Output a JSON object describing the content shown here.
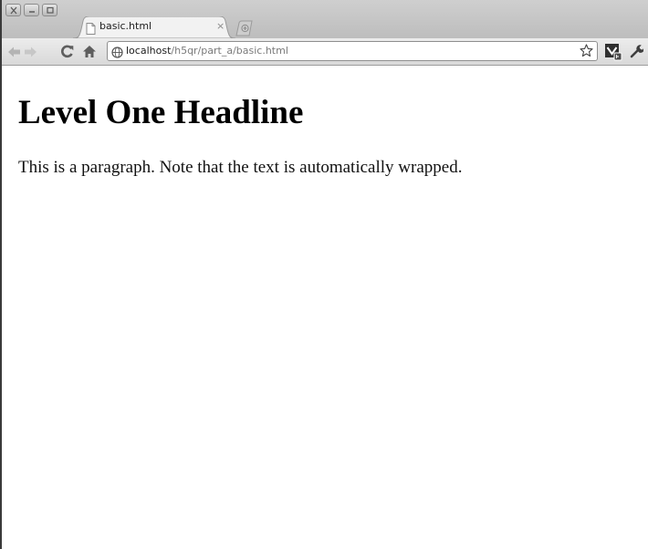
{
  "browser": {
    "tab": {
      "title": "basic.html",
      "close_glyph": "×",
      "favicon": "document-icon"
    },
    "new_tab_icon": "new-tab-icon",
    "window_controls": [
      "close-icon",
      "minimize-icon",
      "maximize-icon"
    ],
    "toolbar": {
      "nav_icons": [
        "back-arrow-icon",
        "forward-arrow-icon",
        "reload-icon",
        "home-icon"
      ],
      "url_host": "localhost",
      "url_path": "/h5qr/part_a/basic.html",
      "bookmark_icon": "star-icon",
      "extension_icon": "extension-icon",
      "menu_icon": "wrench-icon"
    }
  },
  "page": {
    "headline": "Level One Headline",
    "paragraph": "This is a paragraph. Note that the text is automatically wrapped."
  }
}
